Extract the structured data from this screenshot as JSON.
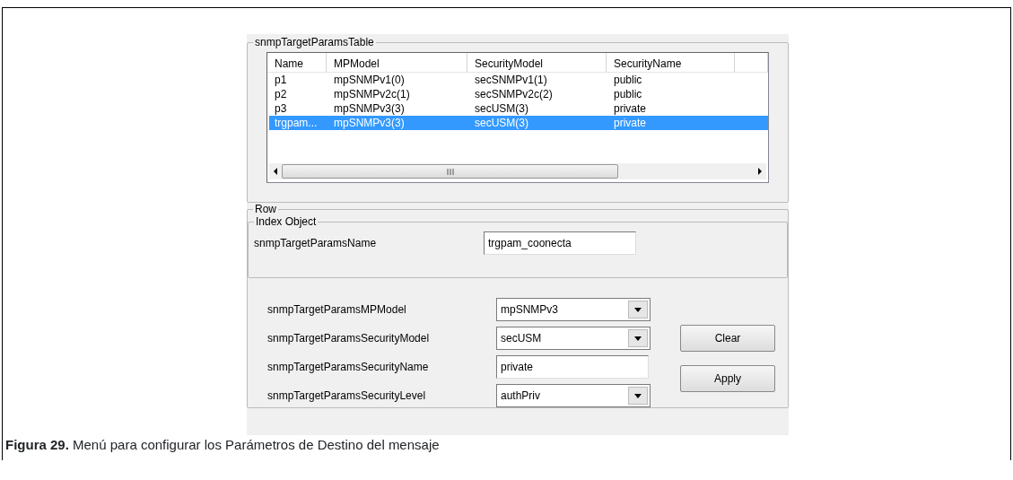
{
  "table_group": {
    "title": "snmpTargetParamsTable",
    "columns": [
      "Name",
      "MPModel",
      "SecurityModel",
      "SecurityName"
    ],
    "rows": [
      {
        "cells": [
          "p1",
          "mpSNMPv1(0)",
          "secSNMPv1(1)",
          "public"
        ],
        "selected": false
      },
      {
        "cells": [
          "p2",
          "mpSNMPv2c(1)",
          "secSNMPv2c(2)",
          "public"
        ],
        "selected": false
      },
      {
        "cells": [
          "p3",
          "mpSNMPv3(3)",
          "secUSM(3)",
          "private"
        ],
        "selected": false
      },
      {
        "cells": [
          "trgpam...",
          "mpSNMPv3(3)",
          "secUSM(3)",
          "private"
        ],
        "selected": true
      }
    ]
  },
  "row_group": {
    "title": "Row",
    "index_group": {
      "title": "Index Object",
      "label": "snmpTargetParamsName",
      "value": "trgpam_coonecta"
    },
    "fields": [
      {
        "kind": "combo",
        "label": "snmpTargetParamsMPModel",
        "value": "mpSNMPv3"
      },
      {
        "kind": "combo",
        "label": "snmpTargetParamsSecurityModel",
        "value": "secUSM"
      },
      {
        "kind": "text",
        "label": "snmpTargetParamsSecurityName",
        "value": "private"
      },
      {
        "kind": "combo",
        "label": "snmpTargetParamsSecurityLevel",
        "value": "authPriv"
      }
    ],
    "buttons": [
      "Clear",
      "Apply"
    ]
  },
  "caption": "**Figura 29.** Menú para configurar los Parámetros de Destino del mensaje"
}
